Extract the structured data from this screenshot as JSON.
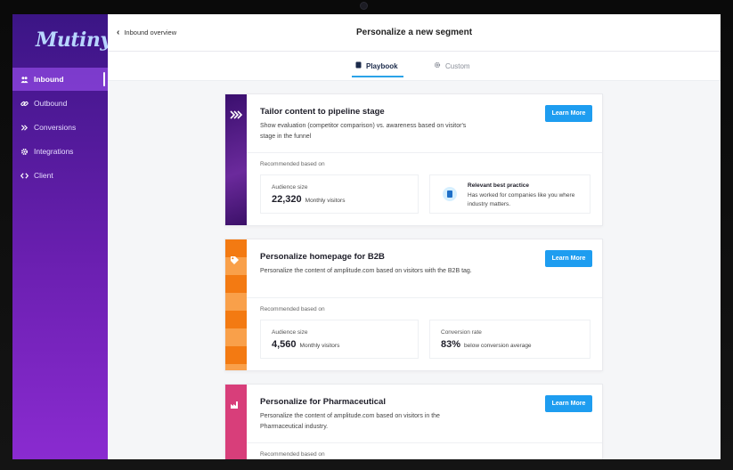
{
  "app": {
    "logo": "Mutiny"
  },
  "sidebar": {
    "items": [
      {
        "label": "Inbound",
        "icon": "people-icon",
        "active": true
      },
      {
        "label": "Outbound",
        "icon": "link-icon",
        "active": false
      },
      {
        "label": "Conversions",
        "icon": "chevrons-icon",
        "active": false
      },
      {
        "label": "Integrations",
        "icon": "gear-icon",
        "active": false
      },
      {
        "label": "Client",
        "icon": "code-icon",
        "active": false
      }
    ]
  },
  "header": {
    "back_label": "Inbound overview",
    "title": "Personalize a new segment"
  },
  "tabs": [
    {
      "label": "Playbook",
      "icon": "playbook-icon",
      "active": true
    },
    {
      "label": "Custom",
      "icon": "gear-icon",
      "active": false
    }
  ],
  "cards": [
    {
      "title": "Tailor content to pipeline stage",
      "description": "Show evaluation (competitor comparison)  vs. awareness based on visitor's stage in the funnel",
      "button": "Learn More",
      "recommended_label": "Recommended based on",
      "stripe_color": "#5a1a8a",
      "stripe_icon": "forward-icon",
      "metric1": {
        "label": "Audience size",
        "value": "22,320",
        "unit": "Monthly visitors"
      },
      "metric2": {
        "title": "Relevant best practice",
        "description": "Has worked for companies like you where industry matters."
      }
    },
    {
      "title": "Personalize homepage for B2B",
      "description": "Personalize the content of amplitude.com based on visitors with the B2B tag.",
      "button": "Learn More",
      "recommended_label": "Recommended based on",
      "stripe_color": "#f08a1c",
      "stripe_icon": "tag-icon",
      "metric1": {
        "label": "Audience size",
        "value": "4,560",
        "unit": "Monthly visitors"
      },
      "metric2": {
        "label": "Conversion rate",
        "value": "83%",
        "unit": "below conversion average"
      }
    },
    {
      "title": "Personalize for Pharmaceutical",
      "description": "Personalize the content of amplitude.com based on visitors in the Pharmaceutical industry.",
      "button": "Learn More",
      "recommended_label": "Recommended based on",
      "stripe_color": "#d83e7a",
      "stripe_icon": "factory-icon"
    }
  ],
  "colors": {
    "accent": "#1e9df0",
    "sidebar_top": "#3b1585",
    "sidebar_bottom": "#8a2bd0"
  }
}
